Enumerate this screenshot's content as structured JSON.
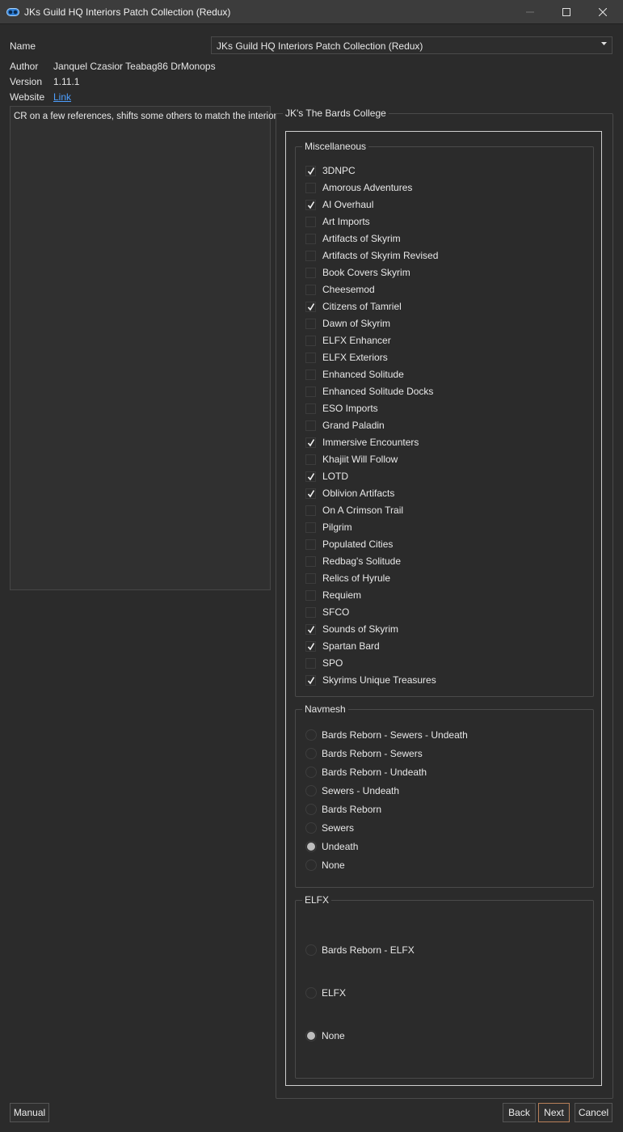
{
  "window": {
    "title": "JKs Guild HQ Interiors Patch Collection (Redux)"
  },
  "info": {
    "name_label": "Name",
    "name_value": "JKs Guild HQ Interiors Patch Collection (Redux)",
    "author_label": "Author",
    "author_value": "Janquel Czasior Teabag86 DrMonops",
    "version_label": "Version",
    "version_value": "1.11.1",
    "website_label": "Website",
    "website_link": "Link"
  },
  "description": "CR on a few references, shifts some others to match the interior",
  "page": {
    "title": "JK's The Bards College"
  },
  "groups": {
    "misc": {
      "title": "Miscellaneous",
      "options": [
        {
          "label": "3DNPC",
          "checked": true
        },
        {
          "label": "Amorous Adventures",
          "checked": false
        },
        {
          "label": "AI Overhaul",
          "checked": true
        },
        {
          "label": "Art Imports",
          "checked": false
        },
        {
          "label": "Artifacts of Skyrim",
          "checked": false
        },
        {
          "label": "Artifacts of Skyrim Revised",
          "checked": false
        },
        {
          "label": "Book Covers Skyrim",
          "checked": false
        },
        {
          "label": "Cheesemod",
          "checked": false
        },
        {
          "label": "Citizens of Tamriel",
          "checked": true
        },
        {
          "label": "Dawn of Skyrim",
          "checked": false
        },
        {
          "label": "ELFX Enhancer",
          "checked": false
        },
        {
          "label": "ELFX Exteriors",
          "checked": false
        },
        {
          "label": "Enhanced Solitude",
          "checked": false
        },
        {
          "label": "Enhanced Solitude Docks",
          "checked": false
        },
        {
          "label": "ESO Imports",
          "checked": false
        },
        {
          "label": "Grand Paladin",
          "checked": false
        },
        {
          "label": "Immersive Encounters",
          "checked": true
        },
        {
          "label": "Khajiit Will Follow",
          "checked": false
        },
        {
          "label": "LOTD",
          "checked": true
        },
        {
          "label": "Oblivion Artifacts",
          "checked": true
        },
        {
          "label": "On A Crimson Trail",
          "checked": false
        },
        {
          "label": "Pilgrim",
          "checked": false
        },
        {
          "label": "Populated Cities",
          "checked": false
        },
        {
          "label": "Redbag's Solitude",
          "checked": false
        },
        {
          "label": "Relics of Hyrule",
          "checked": false
        },
        {
          "label": "Requiem",
          "checked": false
        },
        {
          "label": "SFCO",
          "checked": false
        },
        {
          "label": "Sounds of Skyrim",
          "checked": true
        },
        {
          "label": "Spartan Bard",
          "checked": true
        },
        {
          "label": "SPO",
          "checked": false
        },
        {
          "label": "Skyrims Unique Treasures",
          "checked": true
        }
      ]
    },
    "navmesh": {
      "title": "Navmesh",
      "options": [
        {
          "label": "Bards Reborn - Sewers - Undeath",
          "selected": false
        },
        {
          "label": "Bards Reborn - Sewers",
          "selected": false
        },
        {
          "label": "Bards Reborn - Undeath",
          "selected": false
        },
        {
          "label": "Sewers - Undeath",
          "selected": false
        },
        {
          "label": "Bards Reborn",
          "selected": false
        },
        {
          "label": "Sewers",
          "selected": false
        },
        {
          "label": "Undeath",
          "selected": true
        },
        {
          "label": "None",
          "selected": false
        }
      ]
    },
    "elfx": {
      "title": "ELFX",
      "options": [
        {
          "label": "Bards Reborn - ELFX",
          "selected": false
        },
        {
          "label": "ELFX",
          "selected": false
        },
        {
          "label": "None",
          "selected": true
        }
      ]
    }
  },
  "buttons": {
    "manual": "Manual",
    "back": "Back",
    "next": "Next",
    "cancel": "Cancel"
  },
  "colors": {
    "background": "#2b2b2b",
    "title_bar": "#3c3c3c",
    "link": "#4d9fff",
    "accent_border": "#b8805a"
  }
}
